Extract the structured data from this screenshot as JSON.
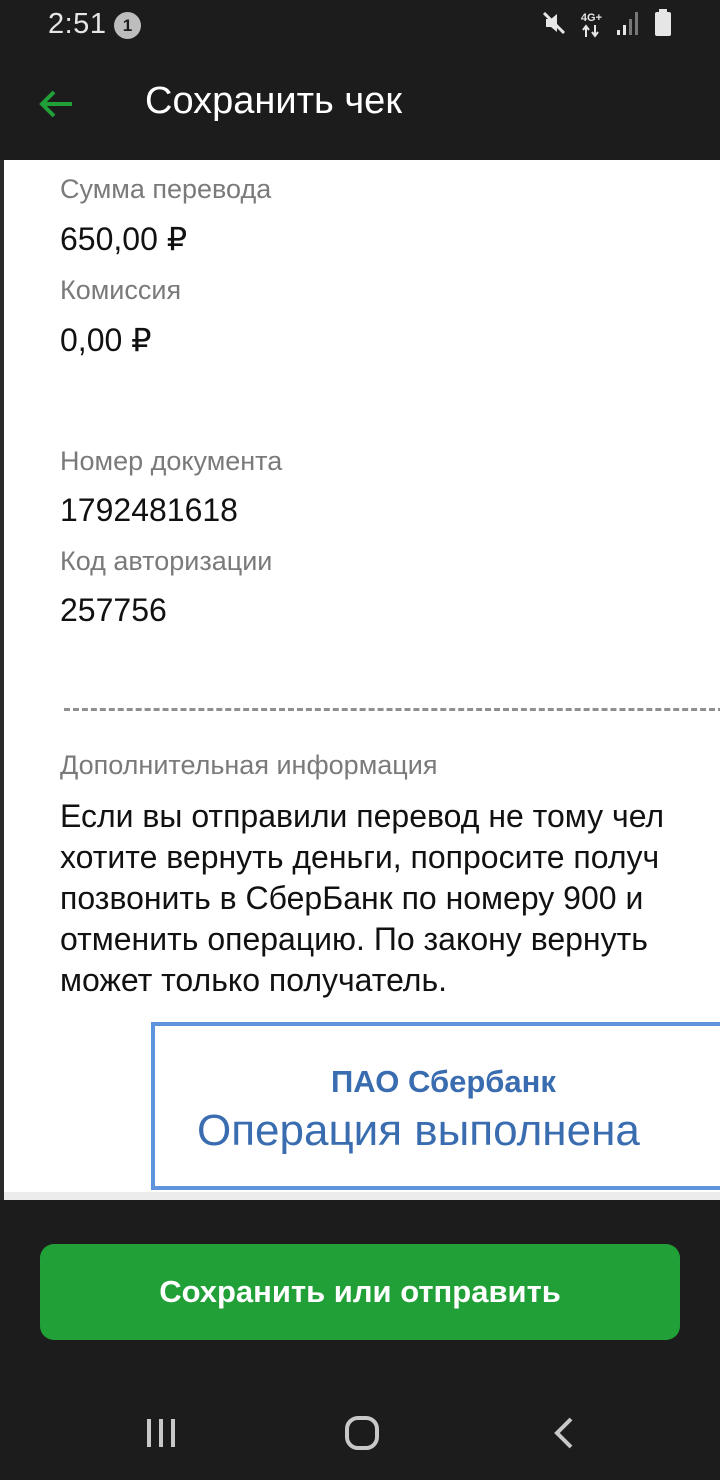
{
  "status_bar": {
    "time": "2:51",
    "notification_count": "1",
    "network_label": "4G+",
    "icons": [
      "mute-icon",
      "network-4g-icon",
      "signal-icon",
      "battery-icon"
    ]
  },
  "app_bar": {
    "title": "Сохранить чек",
    "back_icon": "arrow-left-icon"
  },
  "receipt": {
    "fields": [
      {
        "label": "Сумма перевода",
        "value": "650,00 ₽"
      },
      {
        "label": "Комиссия",
        "value": "0,00 ₽"
      },
      {
        "label": "Номер документа",
        "value": "1792481618"
      },
      {
        "label": "Код авторизации",
        "value": "257756"
      }
    ],
    "additional_info_label": "Дополнительная информация",
    "additional_info_text": "Если вы отправили перевод не тому чел\nхотите вернуть деньги, попросите получ\nпозвонить в СберБанк по номеру 900 и \nотменить операцию. По закону вернуть\nможет только получатель.",
    "stamp": {
      "bank": "ПАО Сбербанк",
      "status": "Операция выполнена"
    }
  },
  "actions": {
    "save_or_send_label": "Сохранить или отправить"
  },
  "nav_bar": {
    "items": [
      "recent-apps-icon",
      "home-icon",
      "back-icon"
    ]
  },
  "colors": {
    "accent": "#21a038",
    "dark_background": "#1c1c1c",
    "stamp_blue": "#5e93dd"
  }
}
